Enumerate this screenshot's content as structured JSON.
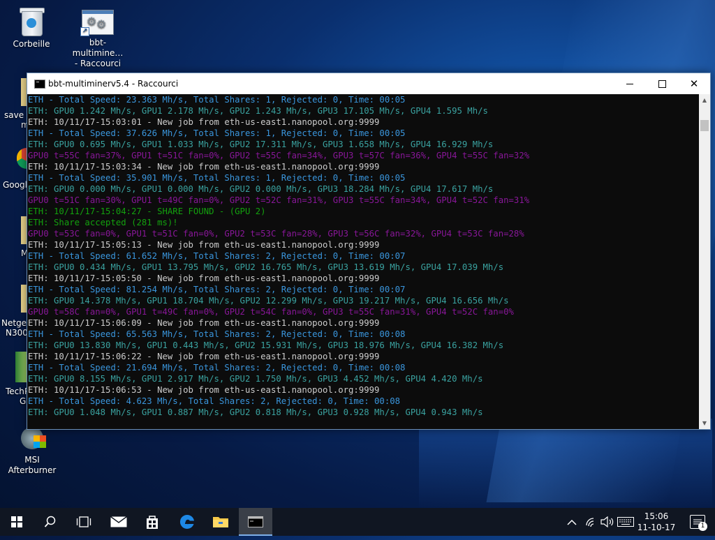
{
  "desktop": {
    "icons": [
      {
        "label": "Corbeille"
      },
      {
        "label": "bbt-multimine…\n- Raccourci"
      }
    ],
    "edge_labels": [
      "save c",
      "m",
      "Google",
      "M",
      "Netgea",
      "N300",
      "TechP",
      "G",
      "MSI Afterburner"
    ]
  },
  "window": {
    "title": "bbt-multiminerv5.4 - Raccourci",
    "minimize_label": "",
    "maximize_label": "",
    "close_label": "✕"
  },
  "console": {
    "lines": [
      {
        "text": "ETH - Total Speed: 23.363 Mh/s, Total Shares: 1, Rejected: 0, Time: 00:05",
        "color": "teal"
      },
      {
        "text": "ETH: GPU0 1.242 Mh/s, GPU1 2.178 Mh/s, GPU2 1.243 Mh/s, GPU3 17.105 Mh/s, GPU4 1.595 Mh/s",
        "color": "cyan"
      },
      {
        "text": "ETH: 10/11/17-15:03:01 - New job from eth-us-east1.nanopool.org:9999",
        "color": "white"
      },
      {
        "text": "ETH - Total Speed: 37.626 Mh/s, Total Shares: 1, Rejected: 0, Time: 00:05",
        "color": "teal"
      },
      {
        "text": "ETH: GPU0 0.695 Mh/s, GPU1 1.033 Mh/s, GPU2 17.311 Mh/s, GPU3 1.658 Mh/s, GPU4 16.929 Mh/s",
        "color": "cyan"
      },
      {
        "text": "GPU0 t=55C fan=37%, GPU1 t=51C fan=0%, GPU2 t=55C fan=34%, GPU3 t=57C fan=36%, GPU4 t=55C fan=32%",
        "color": "mag"
      },
      {
        "text": "ETH: 10/11/17-15:03:34 - New job from eth-us-east1.nanopool.org:9999",
        "color": "white"
      },
      {
        "text": "ETH - Total Speed: 35.901 Mh/s, Total Shares: 1, Rejected: 0, Time: 00:05",
        "color": "teal"
      },
      {
        "text": "ETH: GPU0 0.000 Mh/s, GPU1 0.000 Mh/s, GPU2 0.000 Mh/s, GPU3 18.284 Mh/s, GPU4 17.617 Mh/s",
        "color": "cyan"
      },
      {
        "text": "GPU0 t=51C fan=30%, GPU1 t=49C fan=0%, GPU2 t=52C fan=31%, GPU3 t=55C fan=34%, GPU4 t=52C fan=31%",
        "color": "mag"
      },
      {
        "text": "ETH: 10/11/17-15:04:27 - SHARE FOUND - (GPU 2)",
        "color": "green"
      },
      {
        "text": "ETH: Share accepted (281 ms)!",
        "color": "green"
      },
      {
        "text": "GPU0 t=53C fan=0%, GPU1 t=51C fan=0%, GPU2 t=53C fan=28%, GPU3 t=56C fan=32%, GPU4 t=53C fan=28%",
        "color": "mag"
      },
      {
        "text": "ETH: 10/11/17-15:05:13 - New job from eth-us-east1.nanopool.org:9999",
        "color": "white"
      },
      {
        "text": "ETH - Total Speed: 61.652 Mh/s, Total Shares: 2, Rejected: 0, Time: 00:07",
        "color": "teal"
      },
      {
        "text": "ETH: GPU0 0.434 Mh/s, GPU1 13.795 Mh/s, GPU2 16.765 Mh/s, GPU3 13.619 Mh/s, GPU4 17.039 Mh/s",
        "color": "cyan"
      },
      {
        "text": "ETH: 10/11/17-15:05:50 - New job from eth-us-east1.nanopool.org:9999",
        "color": "white"
      },
      {
        "text": "ETH - Total Speed: 81.254 Mh/s, Total Shares: 2, Rejected: 0, Time: 00:07",
        "color": "teal"
      },
      {
        "text": "ETH: GPU0 14.378 Mh/s, GPU1 18.704 Mh/s, GPU2 12.299 Mh/s, GPU3 19.217 Mh/s, GPU4 16.656 Mh/s",
        "color": "cyan"
      },
      {
        "text": "GPU0 t=58C fan=0%, GPU1 t=49C fan=0%, GPU2 t=54C fan=0%, GPU3 t=55C fan=31%, GPU4 t=52C fan=0%",
        "color": "mag"
      },
      {
        "text": "ETH: 10/11/17-15:06:09 - New job from eth-us-east1.nanopool.org:9999",
        "color": "white"
      },
      {
        "text": "ETH - Total Speed: 65.563 Mh/s, Total Shares: 2, Rejected: 0, Time: 00:08",
        "color": "teal"
      },
      {
        "text": "ETH: GPU0 13.830 Mh/s, GPU1 0.443 Mh/s, GPU2 15.931 Mh/s, GPU3 18.976 Mh/s, GPU4 16.382 Mh/s",
        "color": "cyan"
      },
      {
        "text": "ETH: 10/11/17-15:06:22 - New job from eth-us-east1.nanopool.org:9999",
        "color": "white"
      },
      {
        "text": "ETH - Total Speed: 21.694 Mh/s, Total Shares: 2, Rejected: 0, Time: 00:08",
        "color": "teal"
      },
      {
        "text": "ETH: GPU0 8.155 Mh/s, GPU1 2.917 Mh/s, GPU2 1.750 Mh/s, GPU3 4.452 Mh/s, GPU4 4.420 Mh/s",
        "color": "cyan"
      },
      {
        "text": "ETH: 10/11/17-15:06:53 - New job from eth-us-east1.nanopool.org:9999",
        "color": "white"
      },
      {
        "text": "ETH - Total Speed: 4.623 Mh/s, Total Shares: 2, Rejected: 0, Time: 00:08",
        "color": "teal"
      },
      {
        "text": "ETH: GPU0 1.048 Mh/s, GPU1 0.887 Mh/s, GPU2 0.818 Mh/s, GPU3 0.928 Mh/s, GPU4 0.943 Mh/s",
        "color": "cyan"
      }
    ]
  },
  "taskbar": {
    "items": [
      "start-icon",
      "search-icon",
      "task-view-icon",
      "mail-icon",
      "store-icon",
      "edge-icon",
      "file-explorer-icon",
      "console-icon"
    ],
    "clock_time": "15:06",
    "clock_date": "11-10-17",
    "notification_count": "1"
  },
  "colors": {
    "teal": "#3a96dd",
    "cyan": "#3aa2a0",
    "white": "#cccccc",
    "mag": "#881798",
    "green": "#13a10e"
  }
}
